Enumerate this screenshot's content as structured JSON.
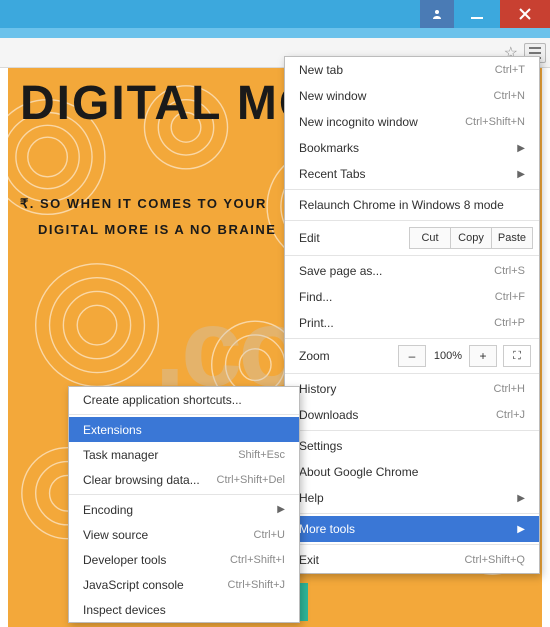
{
  "titlebar": {
    "user": "",
    "min": "",
    "close": ""
  },
  "page": {
    "headline": "DIGITAL MO",
    "sub1": "₹. SO WHEN IT COMES TO YOUR",
    "sub2": "DIGITAL MORE IS A NO BRAINE",
    "watermark": ".com"
  },
  "menu": {
    "newtab": {
      "label": "New tab",
      "sc": "Ctrl+T"
    },
    "newwin": {
      "label": "New window",
      "sc": "Ctrl+N"
    },
    "incog": {
      "label": "New incognito window",
      "sc": "Ctrl+Shift+N"
    },
    "bookmarks": {
      "label": "Bookmarks"
    },
    "recent": {
      "label": "Recent Tabs"
    },
    "relaunch": {
      "label": "Relaunch Chrome in Windows 8 mode"
    },
    "edit": {
      "label": "Edit",
      "cut": "Cut",
      "copy": "Copy",
      "paste": "Paste"
    },
    "save": {
      "label": "Save page as...",
      "sc": "Ctrl+S"
    },
    "find": {
      "label": "Find...",
      "sc": "Ctrl+F"
    },
    "print": {
      "label": "Print...",
      "sc": "Ctrl+P"
    },
    "zoom": {
      "label": "Zoom",
      "value": "100%",
      "minus": "–",
      "plus": "+"
    },
    "history": {
      "label": "History",
      "sc": "Ctrl+H"
    },
    "downloads": {
      "label": "Downloads",
      "sc": "Ctrl+J"
    },
    "settings": {
      "label": "Settings"
    },
    "about": {
      "label": "About Google Chrome"
    },
    "help": {
      "label": "Help"
    },
    "moretools": {
      "label": "More tools"
    },
    "exit": {
      "label": "Exit",
      "sc": "Ctrl+Shift+Q"
    }
  },
  "submenu": {
    "createapp": {
      "label": "Create application shortcuts..."
    },
    "extensions": {
      "label": "Extensions"
    },
    "taskmgr": {
      "label": "Task manager",
      "sc": "Shift+Esc"
    },
    "clear": {
      "label": "Clear browsing data...",
      "sc": "Ctrl+Shift+Del"
    },
    "encoding": {
      "label": "Encoding"
    },
    "viewsrc": {
      "label": "View source",
      "sc": "Ctrl+U"
    },
    "devtools": {
      "label": "Developer tools",
      "sc": "Ctrl+Shift+I"
    },
    "jsconsole": {
      "label": "JavaScript console",
      "sc": "Ctrl+Shift+J"
    },
    "inspect": {
      "label": "Inspect devices"
    }
  }
}
